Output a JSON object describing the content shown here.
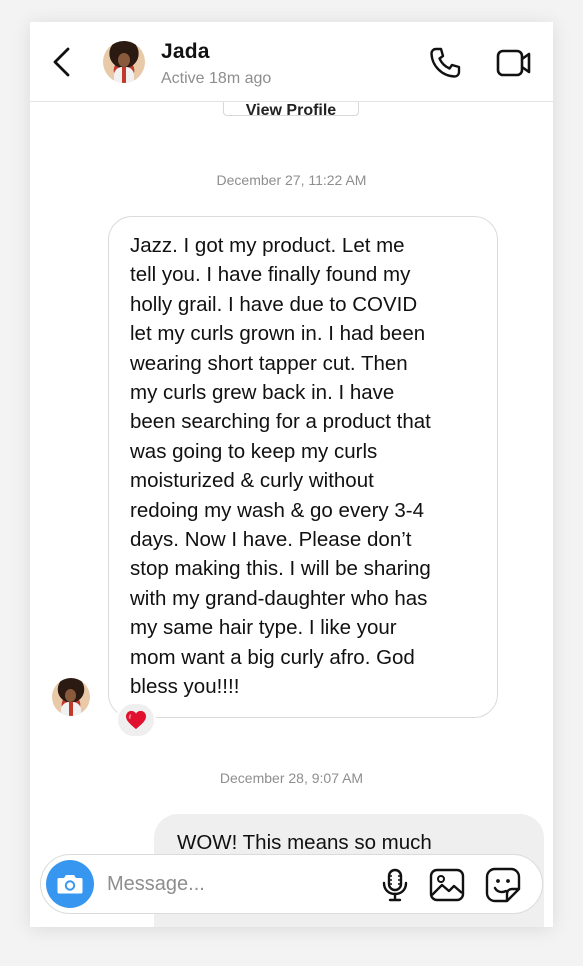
{
  "header": {
    "back_icon": "chevron-left-icon",
    "name": "Jada",
    "status": "Active 18m ago",
    "call_icon": "phone-icon",
    "video_icon": "video-camera-icon"
  },
  "profile_button": {
    "label": "View Profile"
  },
  "thread": {
    "timestamps": [
      "December 27, 11:22 AM",
      "December 28, 9:07 AM"
    ],
    "incoming": {
      "text": "Jazz. I got my product. Let me\ntell you. I have finally found my\nholly grail. I have due to COVID\nlet my curls grown in. I had been\nwearing short tapper cut. Then\nmy curls grew back in. I have\nbeen searching for a product that\nwas going to keep my curls\nmoisturized & curly without\nredoing my wash & go every 3-4\ndays. Now I have. Please don’t\nstop making this. I will be sharing\nwith my grand-daughter who has\nmy same hair type. I like your\nmom want a big curly afro. God\nbless you!!!!",
      "reaction": "❤️"
    },
    "outgoing": {
      "text": "WOW! This means so much"
    }
  },
  "composer": {
    "placeholder": "Message...",
    "camera_icon": "camera-icon",
    "mic_icon": "microphone-icon",
    "gallery_icon": "image-icon",
    "sticker_icon": "sticker-icon"
  },
  "colors": {
    "accent": "#3797f0",
    "muted_text": "#8e8e8e",
    "incoming_border": "#dbdbdb",
    "outgoing_bg": "#efefef",
    "heart": "#e0102e"
  }
}
